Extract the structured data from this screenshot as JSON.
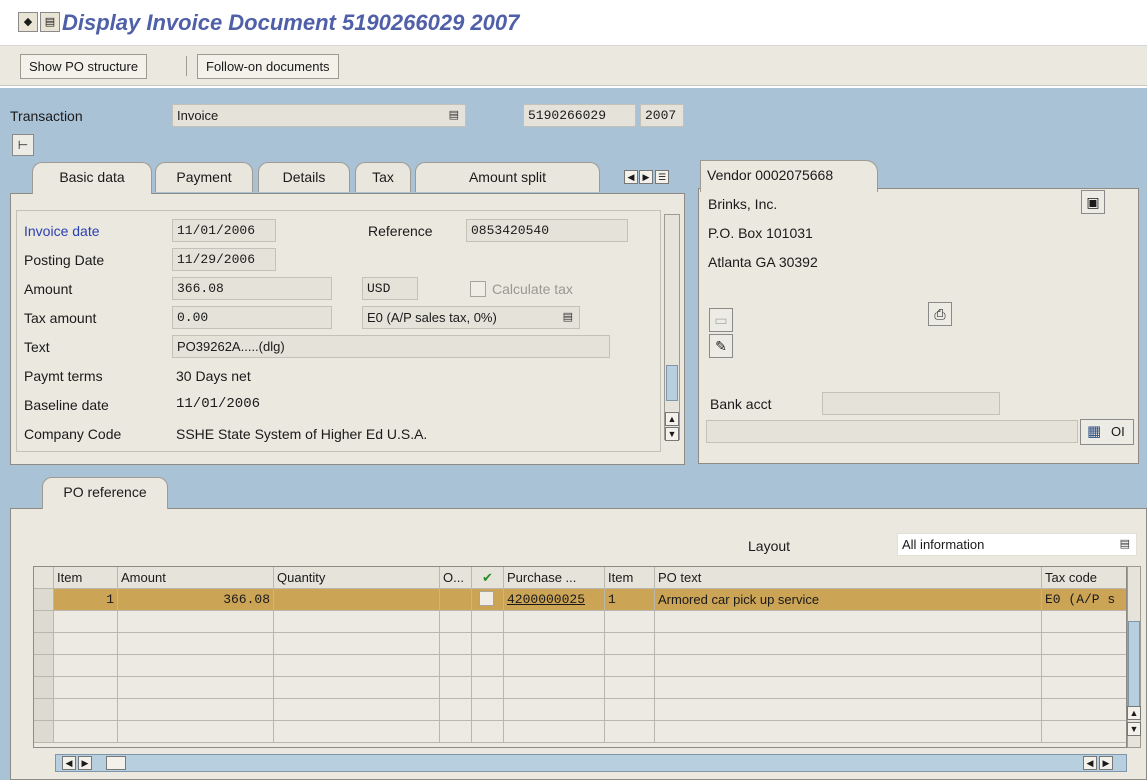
{
  "window": {
    "title": "Display Invoice Document 5190266029 2007"
  },
  "toolbar": {
    "show_po_structure": "Show PO structure",
    "follow_on_documents": "Follow-on documents"
  },
  "header": {
    "transaction_label": "Transaction",
    "transaction_value": "Invoice",
    "doc_number": "5190266029",
    "fiscal_year": "2007"
  },
  "tabs": [
    {
      "label": "Basic data"
    },
    {
      "label": "Payment"
    },
    {
      "label": "Details"
    },
    {
      "label": "Tax"
    },
    {
      "label": "Amount split"
    }
  ],
  "basic": {
    "invoice_date_label": "Invoice date",
    "invoice_date": "11/01/2006",
    "reference_label": "Reference",
    "reference": "0853420540",
    "posting_date_label": "Posting Date",
    "posting_date": "11/29/2006",
    "amount_label": "Amount",
    "amount": "366.08",
    "currency": "USD",
    "calculate_tax": "Calculate tax",
    "tax_amount_label": "Tax amount",
    "tax_amount": "0.00",
    "tax_code": "E0 (A/P sales tax, 0%)",
    "text_label": "Text",
    "text": "PO39262A.....(dlg)",
    "paymt_terms_label": "Paymt terms",
    "paymt_terms": "30 Days net",
    "baseline_date_label": "Baseline date",
    "baseline_date": "11/01/2006",
    "company_code_label": "Company Code",
    "company_code": "SSHE State System of Higher Ed U.S.A."
  },
  "vendor": {
    "tab_label": "Vendor 0002075668",
    "name": "Brinks, Inc.",
    "address1": "P.O. Box 101031",
    "address2": "Atlanta GA  30392",
    "bank_acct_label": "Bank acct",
    "oi_label": "OI"
  },
  "po_ref": {
    "tab_label": "PO reference",
    "layout_label": "Layout",
    "layout_value": "All information",
    "columns": {
      "item": "Item",
      "amount": "Amount",
      "quantity": "Quantity",
      "o": "O...",
      "purchase": "Purchase ...",
      "item2": "Item",
      "po_text": "PO text",
      "tax_code": "Tax code"
    },
    "row": {
      "item": "1",
      "amount": "366.08",
      "purchase": "4200000025",
      "item2": "1",
      "po_text": "Armored car pick up service",
      "tax_code": "E0 (A/P s"
    }
  },
  "colors": {
    "title": "#4f5fa8",
    "workarea": "#a9c2d6",
    "panel": "#eae8df",
    "selected_row": "#cba456",
    "link_label": "#2a3fb0"
  }
}
